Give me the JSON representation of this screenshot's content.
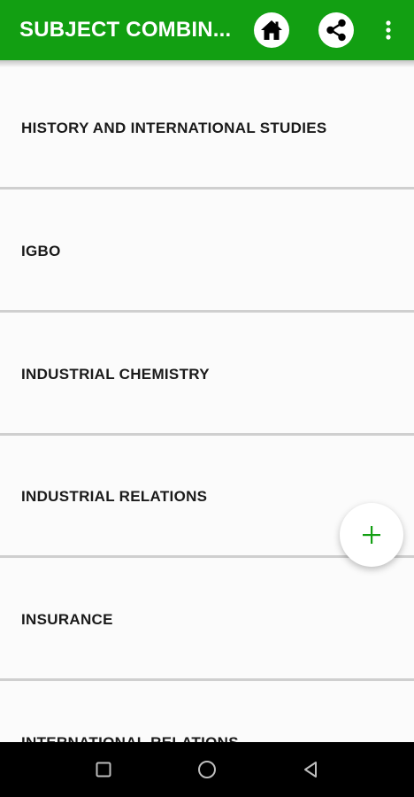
{
  "appbar": {
    "title": "SUBJECT COMBIN...",
    "home_icon": "home-icon",
    "share_icon": "share-icon",
    "menu_icon": "more-vert-icon",
    "color": "#129f12"
  },
  "list": {
    "items": [
      {
        "label": "HISTORY AND INTERNATIONAL STUDIES"
      },
      {
        "label": "IGBO"
      },
      {
        "label": "INDUSTRIAL CHEMISTRY"
      },
      {
        "label": "INDUSTRIAL RELATIONS"
      },
      {
        "label": "INSURANCE"
      },
      {
        "label": "INTERNATIONAL RELATIONS"
      }
    ]
  },
  "fab": {
    "icon": "plus-icon",
    "color": "#129f12"
  },
  "navbar": {
    "recents_icon": "square-icon",
    "home_icon": "circle-icon",
    "back_icon": "triangle-back-icon"
  }
}
